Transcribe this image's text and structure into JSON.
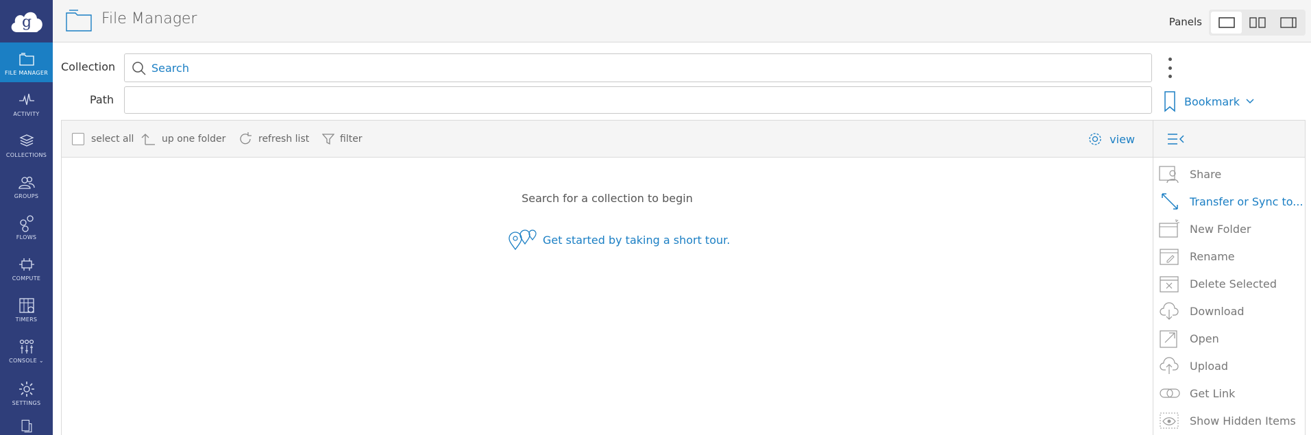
{
  "sidebar": {
    "items": [
      {
        "label": "FILE MANAGER",
        "icon": "folder-icon",
        "active": true
      },
      {
        "label": "ACTIVITY",
        "icon": "activity-icon"
      },
      {
        "label": "COLLECTIONS",
        "icon": "layers-icon"
      },
      {
        "label": "GROUPS",
        "icon": "groups-icon"
      },
      {
        "label": "FLOWS",
        "icon": "flows-icon"
      },
      {
        "label": "COMPUTE",
        "icon": "compute-icon"
      },
      {
        "label": "TIMERS",
        "icon": "timers-icon"
      },
      {
        "label": "CONSOLE",
        "icon": "console-icon"
      },
      {
        "label": "SETTINGS",
        "icon": "gear-icon"
      }
    ]
  },
  "header": {
    "title": "File Manager",
    "panels_label": "Panels"
  },
  "collection": {
    "label": "Collection",
    "placeholder": "Search"
  },
  "path": {
    "label": "Path",
    "value": ""
  },
  "bookmark_label": "Bookmark",
  "toolbar": {
    "select_all": "select all",
    "up_one_folder": "up one folder",
    "refresh_list": "refresh list",
    "filter": "filter",
    "view": "view"
  },
  "empty_state": {
    "message": "Search for a collection to begin",
    "tour_link": "Get started by taking a short tour."
  },
  "actions": [
    {
      "label": "Share",
      "icon": "share-icon"
    },
    {
      "label": "Transfer or Sync to...",
      "icon": "transfer-icon",
      "primary": true
    },
    {
      "label": "New Folder",
      "icon": "new-folder-icon"
    },
    {
      "label": "Rename",
      "icon": "rename-icon"
    },
    {
      "label": "Delete Selected",
      "icon": "delete-icon"
    },
    {
      "label": "Download",
      "icon": "download-icon"
    },
    {
      "label": "Open",
      "icon": "open-icon"
    },
    {
      "label": "Upload",
      "icon": "upload-icon"
    },
    {
      "label": "Get Link",
      "icon": "link-icon"
    },
    {
      "label": "Show Hidden Items",
      "icon": "eye-icon"
    }
  ],
  "colors": {
    "sidebar": "#2f3e7a",
    "active": "#1b7fc4",
    "link": "#1b7fc4"
  }
}
